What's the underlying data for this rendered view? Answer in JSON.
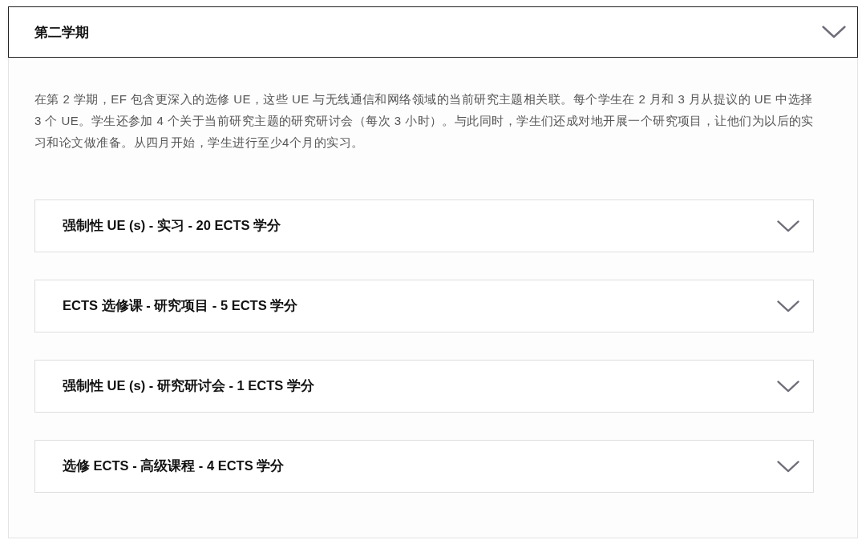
{
  "section": {
    "title": "第二学期",
    "description": "在第 2 学期，EF 包含更深入的选修 UE，这些 UE 与无线通信和网络领域的当前研究主题相关联。每个学生在 2 月和 3 月从提议的 UE 中选择 3 个 UE。学生还参加 4 个关于当前研究主题的研究研讨会（每次 3 小时）。与此同时，学生们还成对地开展一个研究项目，让他们为以后的实习和论文做准备。从四月开始，学生进行至少4个月的实习。",
    "items": [
      {
        "title": "强制性 UE (s) - 实习 - 20 ECTS 学分"
      },
      {
        "title": "ECTS 选修课 - 研究项目 - 5 ECTS 学分"
      },
      {
        "title": "强制性 UE (s) - 研究研讨会 - 1 ECTS 学分"
      },
      {
        "title": "选修 ECTS - 高级课程 - 4 ECTS 学分"
      }
    ]
  }
}
